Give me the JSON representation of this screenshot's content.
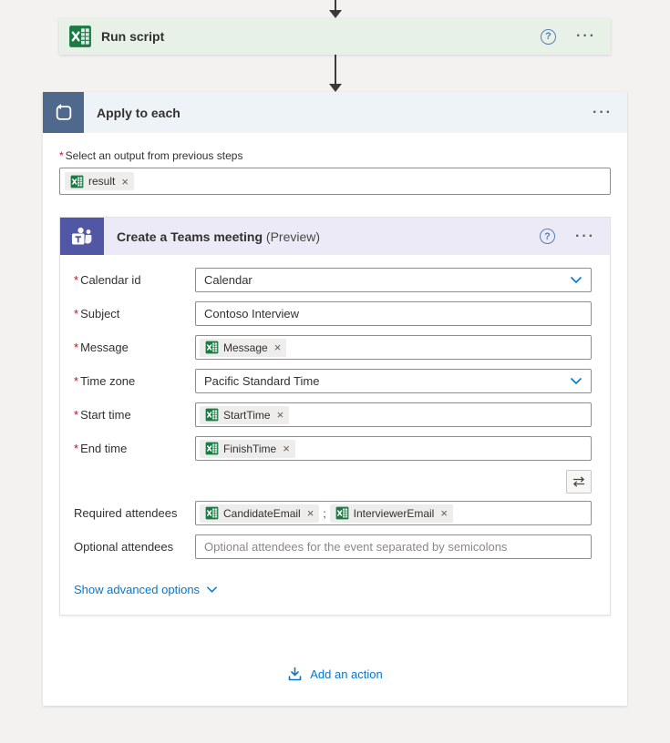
{
  "ui": {
    "menu": "···",
    "help": "?",
    "required_mark": "*",
    "close": "×",
    "separator": ";"
  },
  "colors": {
    "accent_link": "#0078d4",
    "required_red": "#c50f1f",
    "excel_green": "#1a7c44",
    "teams_purple": "#5157a4",
    "loop_blue": "#4f698c",
    "run_header_bg": "#e8f1e8",
    "apply_header_bg": "#eef3f8",
    "teams_header_bg": "#eceaf6",
    "canvas_bg": "#f3f2f1"
  },
  "run_script": {
    "title": "Run script"
  },
  "apply_to_each": {
    "title": "Apply to each",
    "select_output_label": "Select an output from previous steps",
    "output_token": {
      "name": "result"
    }
  },
  "teams_meeting": {
    "title": "Create a Teams meeting",
    "preview_suffix": "(Preview)",
    "show_advanced_label": "Show advanced options",
    "fields": [
      {
        "label": "Calendar id",
        "required": true,
        "type": "select",
        "value": "Calendar"
      },
      {
        "label": "Subject",
        "required": true,
        "type": "text",
        "value": "Contoso Interview"
      },
      {
        "label": "Message",
        "required": true,
        "type": "token",
        "token": {
          "name": "Message"
        }
      },
      {
        "label": "Time zone",
        "required": true,
        "type": "select",
        "value": "Pacific Standard Time"
      },
      {
        "label": "Start time",
        "required": true,
        "type": "token",
        "token": {
          "name": "StartTime"
        }
      },
      {
        "label": "End time",
        "required": true,
        "type": "token",
        "token": {
          "name": "FinishTime"
        }
      },
      {
        "label": "Required attendees",
        "required": false,
        "type": "tokens",
        "tokens": [
          {
            "name": "CandidateEmail"
          },
          {
            "name": "InterviewerEmail"
          }
        ]
      },
      {
        "label": "Optional attendees",
        "required": false,
        "type": "placeholder",
        "placeholder": "Optional attendees for the event separated by semicolons"
      }
    ]
  },
  "add_action": {
    "label": "Add an action"
  }
}
